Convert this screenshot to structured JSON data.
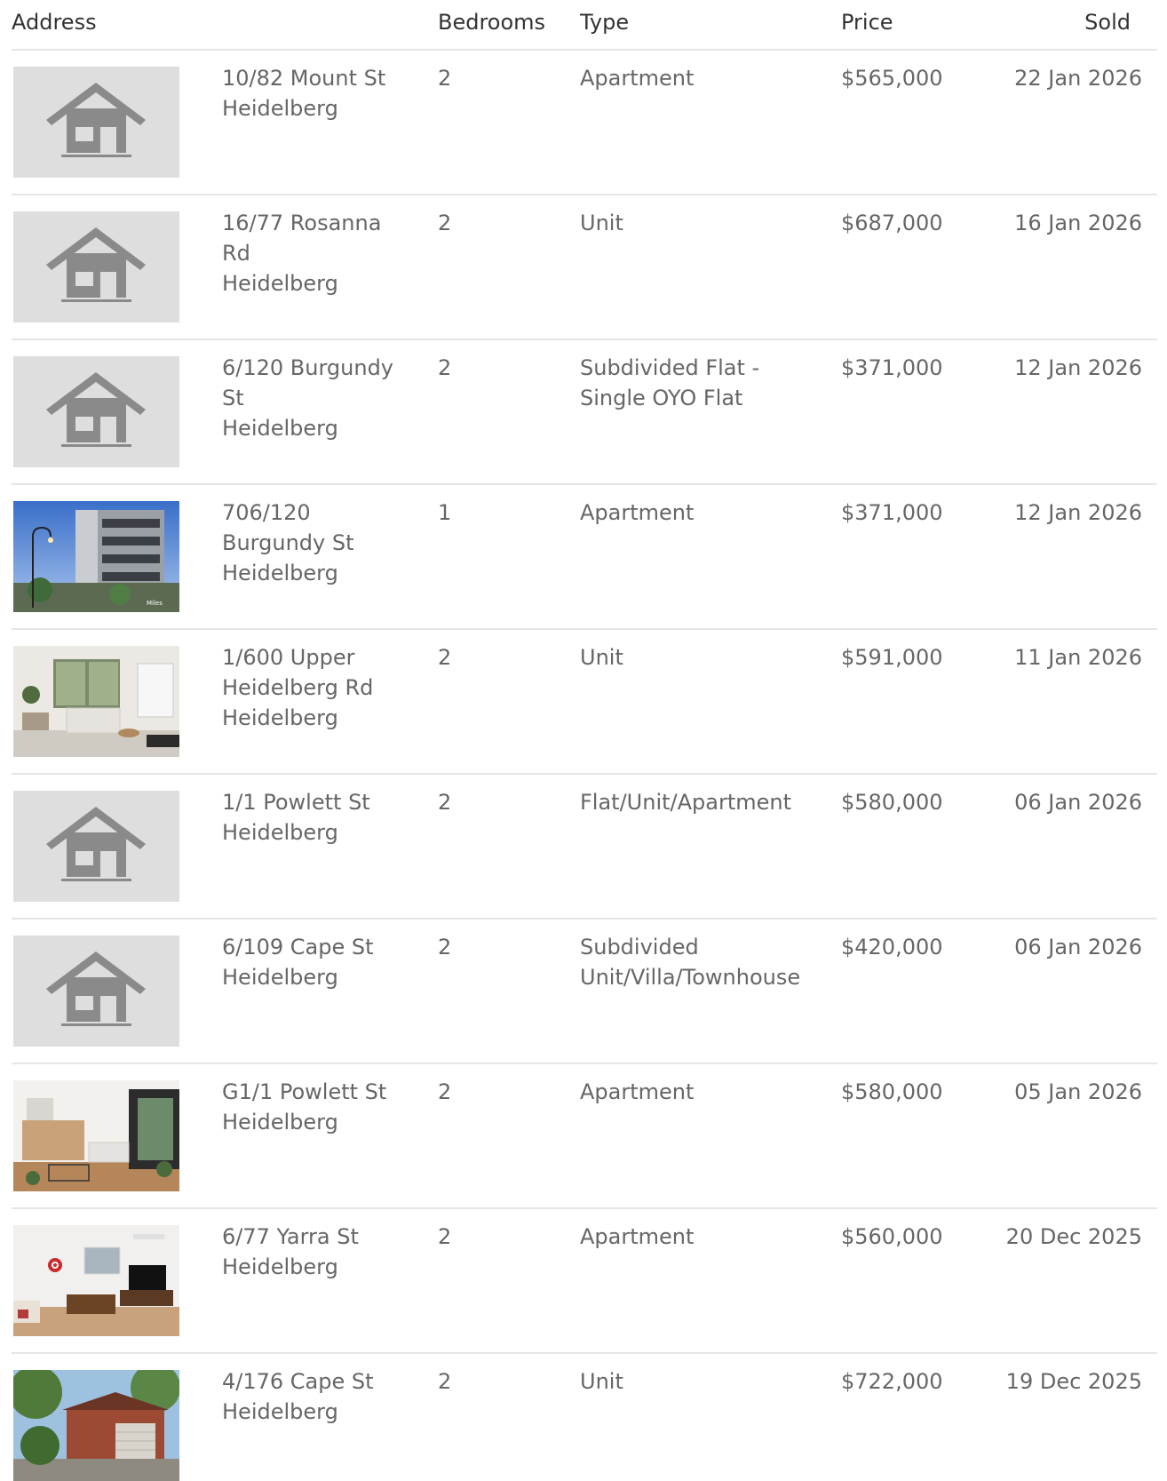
{
  "table": {
    "headers": {
      "address": "Address",
      "bedrooms": "Bedrooms",
      "type": "Type",
      "price": "Price",
      "sold": "Sold"
    },
    "rows": [
      {
        "street": "10/82 Mount St",
        "suburb": "Heidelberg",
        "bedrooms": "2",
        "type": "Apartment",
        "price": "$565,000",
        "sold": "22 Jan 2026",
        "image": "house-placeholder-icon"
      },
      {
        "street": "16/77 Rosanna Rd",
        "suburb": "Heidelberg",
        "bedrooms": "2",
        "type": "Unit",
        "price": "$687,000",
        "sold": "16 Jan 2026",
        "image": "house-placeholder-icon"
      },
      {
        "street": "6/120 Burgundy St",
        "suburb": "Heidelberg",
        "bedrooms": "2",
        "type": "Subdivided Flat - Single OYO Flat",
        "price": "$371,000",
        "sold": "12 Jan 2026",
        "image": "house-placeholder-icon"
      },
      {
        "street": "706/120 Burgundy St",
        "suburb": "Heidelberg",
        "bedrooms": "1",
        "type": "Apartment",
        "price": "$371,000",
        "sold": "12 Jan 2026",
        "image": "building-exterior-photo"
      },
      {
        "street": "1/600 Upper Heidelberg Rd",
        "suburb": "Heidelberg",
        "bedrooms": "2",
        "type": "Unit",
        "price": "$591,000",
        "sold": "11 Jan 2026",
        "image": "living-room-photo"
      },
      {
        "street": "1/1 Powlett St",
        "suburb": "Heidelberg",
        "bedrooms": "2",
        "type": "Flat/Unit/Apartment",
        "price": "$580,000",
        "sold": "06 Jan 2026",
        "image": "house-placeholder-icon"
      },
      {
        "street": "6/109 Cape St",
        "suburb": "Heidelberg",
        "bedrooms": "2",
        "type": "Subdivided Unit/Villa/Townhouse",
        "price": "$420,000",
        "sold": "06 Jan 2026",
        "image": "house-placeholder-icon"
      },
      {
        "street": "G1/1 Powlett St",
        "suburb": "Heidelberg",
        "bedrooms": "2",
        "type": "Apartment",
        "price": "$580,000",
        "sold": "05 Jan 2026",
        "image": "kitchen-living-photo"
      },
      {
        "street": "6/77 Yarra St",
        "suburb": "Heidelberg",
        "bedrooms": "2",
        "type": "Apartment",
        "price": "$560,000",
        "sold": "20 Dec 2025",
        "image": "lounge-room-photo"
      },
      {
        "street": "4/176 Cape St",
        "suburb": "Heidelberg",
        "bedrooms": "2",
        "type": "Unit",
        "price": "$722,000",
        "sold": "19 Dec 2025",
        "image": "brick-unit-exterior-photo"
      }
    ]
  },
  "photo_watermark": "Miles"
}
